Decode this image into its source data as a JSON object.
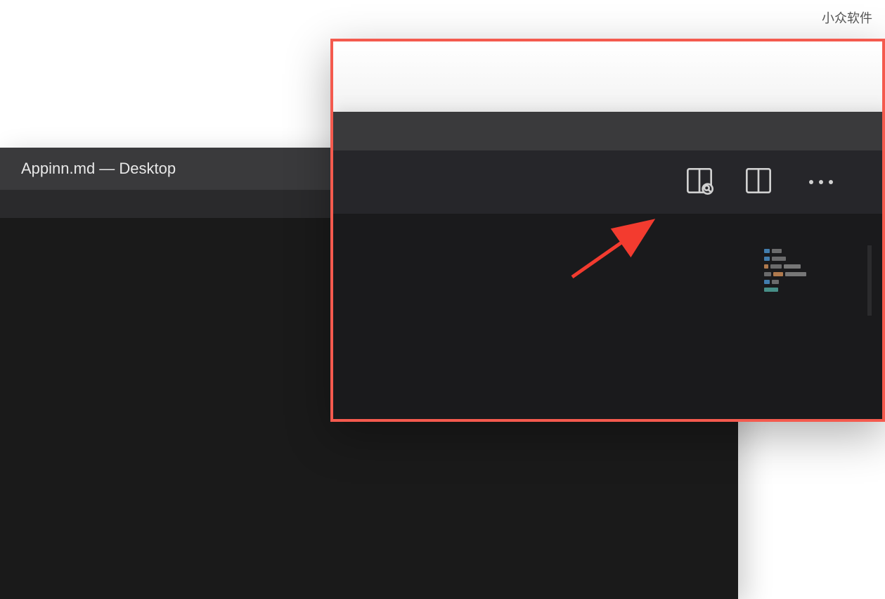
{
  "watermark": "小众软件",
  "back_window": {
    "title": "Appinn.md — Desktop"
  },
  "zoom_inset": {
    "toolbar": {
      "preview_icon_name": "open-preview-to-side-icon",
      "split_icon_name": "split-editor-icon",
      "more_icon_name": "more-actions-icon"
    }
  },
  "annotation": {
    "arrow_color": "#f33b2f",
    "highlight_border_color": "#f45a4e"
  },
  "minimap_colors": {
    "blue": "#4a8fc7",
    "orange": "#c98a56",
    "gray": "#7a7a7a",
    "teal": "#4fa39a"
  }
}
